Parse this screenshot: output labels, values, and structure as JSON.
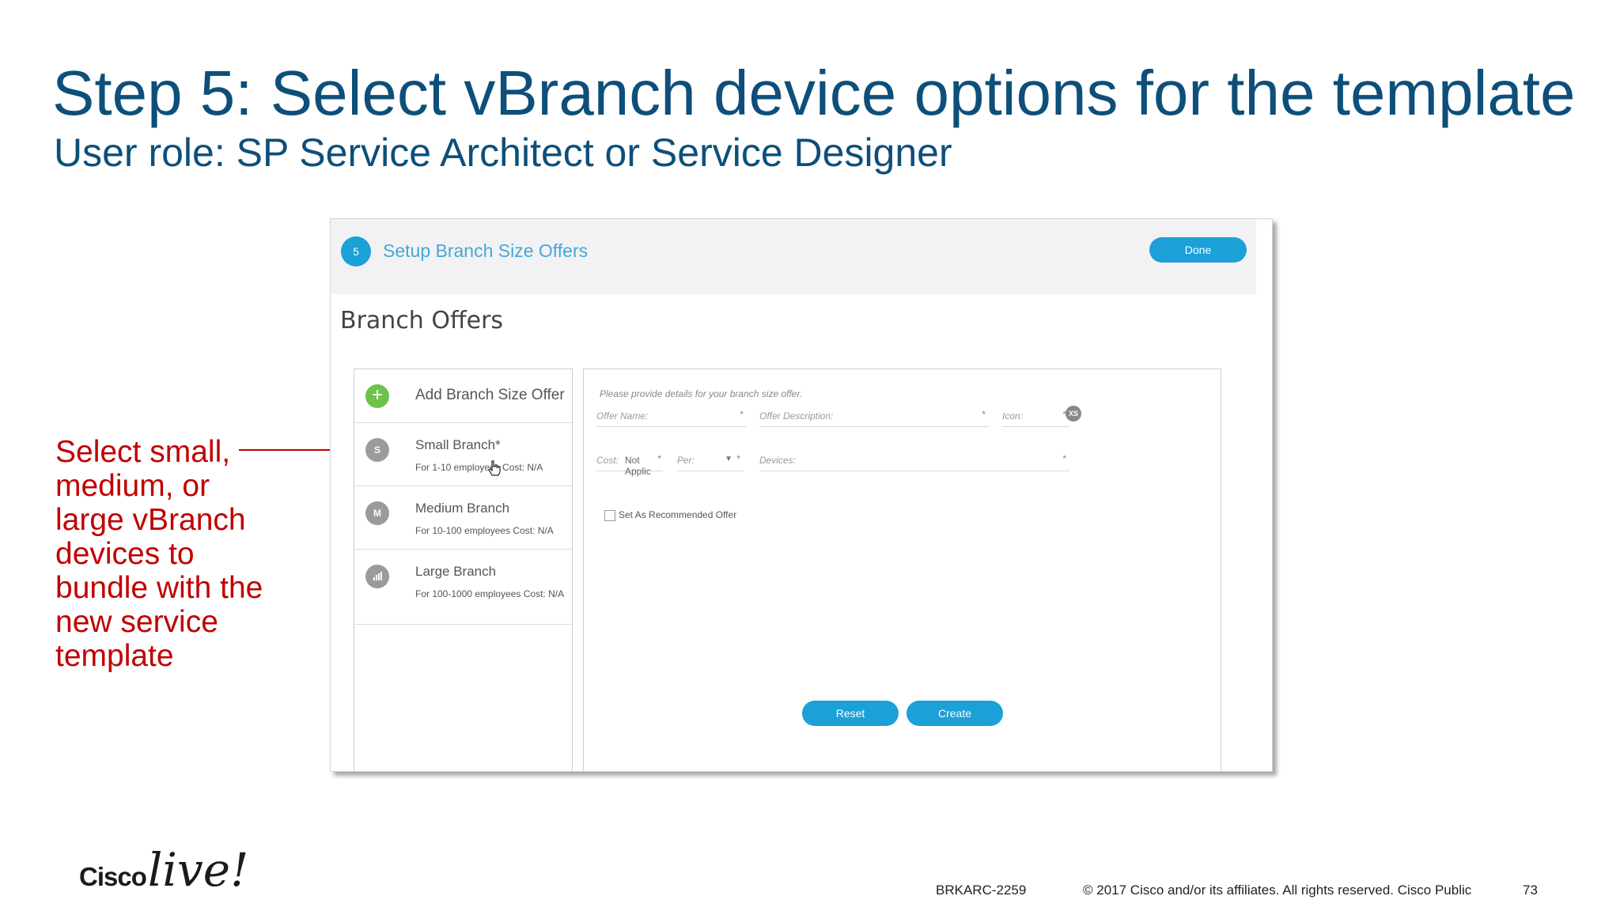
{
  "slide": {
    "title": "Step 5: Select vBranch device options for the template",
    "subtitle": "User role: SP Service Architect or Service Designer",
    "callout": "Select small, medium, or large vBranch devices to bundle with the new service template"
  },
  "header": {
    "step_number": "5",
    "title": "Setup Branch Size Offers",
    "done_label": "Done"
  },
  "section_title": "Branch Offers",
  "offers": {
    "add_label": "Add Branch Size Offer",
    "add_icon": "+",
    "items": [
      {
        "badge": "S",
        "title": "Small Branch*",
        "desc": "For 1-10 employees Cost: N/A"
      },
      {
        "badge": "M",
        "title": "Medium Branch",
        "desc": "For 10-100 employees Cost: N/A"
      },
      {
        "badge": "",
        "badge_icon": "signal-bars-icon",
        "title": "Large Branch",
        "desc": "For 100-1000 employees Cost: N/A"
      }
    ]
  },
  "form": {
    "hint": "Please provide details for your branch size offer.",
    "offer_name_label": "Offer Name:",
    "offer_description_label": "Offer Description:",
    "icon_label": "Icon:",
    "icon_value": "XS",
    "cost_label": "Cost:",
    "cost_value": "Not Applic",
    "per_label": "Per:",
    "devices_label": "Devices:",
    "required_mark": "*",
    "recommended_label": "Set As Recommended Offer",
    "recommended_checked": false,
    "reset_label": "Reset",
    "create_label": "Create"
  },
  "footer": {
    "logo_cisco": "Cisco",
    "logo_live": "live!",
    "session_id": "BRKARC-2259",
    "copyright": "© 2017  Cisco and/or its affiliates. All rights reserved.   Cisco Public",
    "page_number": "73"
  },
  "colors": {
    "title_blue": "#0d4f7a",
    "callout_red": "#c00000",
    "button_blue": "#1ba0d8",
    "add_green": "#6cc24a"
  }
}
